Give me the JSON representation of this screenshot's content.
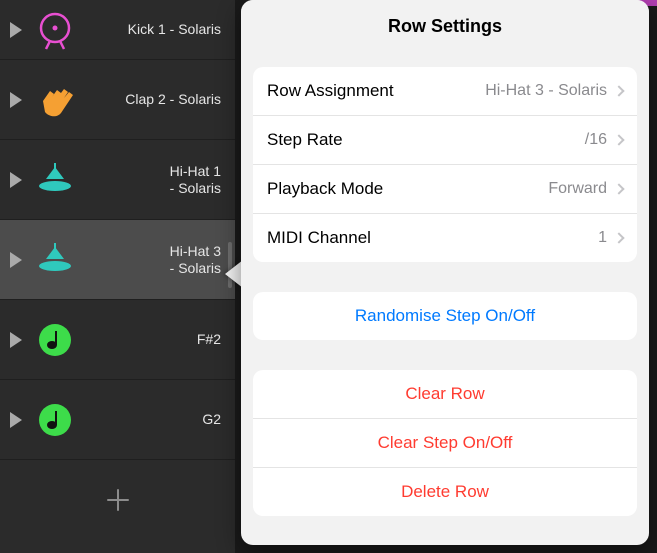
{
  "tracks": [
    {
      "label": "Kick 1 - Solaris"
    },
    {
      "label": "Clap 2 - Solaris"
    },
    {
      "label": "Hi-Hat 1\n- Solaris"
    },
    {
      "label": "Hi-Hat 3\n- Solaris"
    },
    {
      "label": "F#2"
    },
    {
      "label": "G2"
    }
  ],
  "popover": {
    "title": "Row Settings",
    "settings": {
      "assignment": {
        "label": "Row Assignment",
        "value": "Hi-Hat 3 - Solaris"
      },
      "steprate": {
        "label": "Step Rate",
        "value": "/16"
      },
      "playback": {
        "label": "Playback Mode",
        "value": "Forward"
      },
      "midi": {
        "label": "MIDI Channel",
        "value": "1"
      }
    },
    "randomise": "Randomise Step On/Off",
    "clearRow": "Clear Row",
    "clearStep": "Clear Step On/Off",
    "deleteRow": "Delete Row"
  }
}
